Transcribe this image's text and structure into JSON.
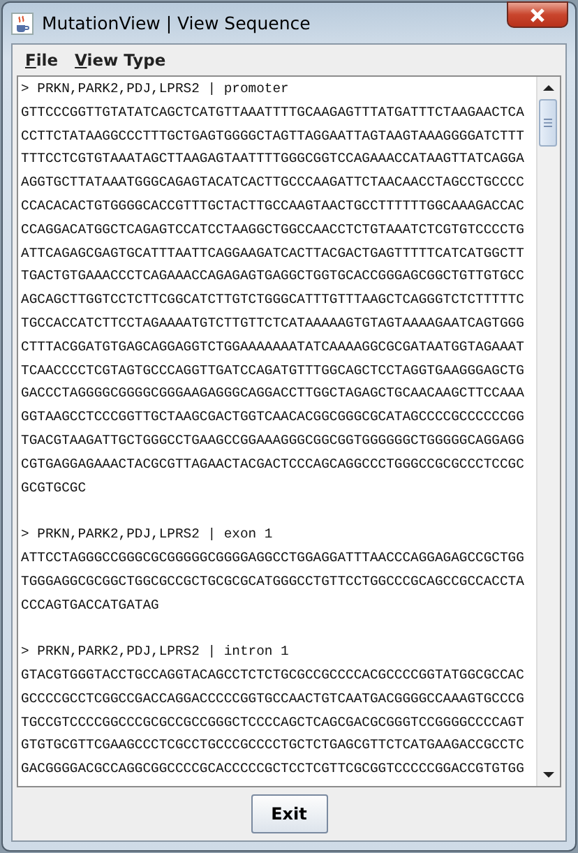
{
  "window": {
    "title": "MutationView | View Sequence"
  },
  "menu": [
    {
      "label": "File"
    },
    {
      "label": "View Type"
    }
  ],
  "records": [
    {
      "header": "> PRKN,PARK2,PDJ,LPRS2 | promoter",
      "lines": [
        "GTTCCCGGTTGTATATCAGCTCATGTTAAATTTTGCAAGAGTTTATGATTTCTAAGAACTCA",
        "CCTTCTATAAGGCCCTTTGCTGAGTGGGGCTAGTTAGGAATTAGTAAGTAAAGGGGATCTTT",
        "TTTCCTCGTGTAAATAGCTTAAGAGTAATTTTGGGCGGTCCAGAAACCATAAGTTATCAGGA",
        "AGGTGCTTATAAATGGGCAGAGTACATCACTTGCCCAAGATTCTAACAACCTAGCCTGCCCC",
        "CCACACACTGTGGGGCACCGTTTGCTACTTGCCAAGTAACTGCCTTTTTTGGCAAAGACCAC",
        "CCAGGACATGGCTCAGAGTCCATCCTAAGGCTGGCCAACCTCTGTAAATCTCGTGTCCCCTG",
        "ATTCAGAGCGAGTGCATTTAATTCAGGAAGATCACTTACGACTGAGTTTTTCATCATGGCTT",
        "TGACTGTGAAACCCTCAGAAACCAGAGAGTGAGGCTGGTGCACCGGGAGCGGCTGTTGTGCC",
        "AGCAGCTTGGTCCTCTTCGGCATCTTGTCTGGGCATTTGTTTAAGCTCAGGGTCTCTTTTTC",
        "TGCCACCATCTTCCTAGAAAATGTCTTGTTCTCATAAAAAGTGTAGTAAAAGAATCAGTGGG",
        "CTTTACGGATGTGAGCAGGAGGTCTGGAAAAAAATATCAAAAGGCGCGATAATGGTAGAAAT",
        "TCAACCCCTCGTAGTGCCCAGGTTGATCCAGATGTTTGGCAGCTCCTAGGTGAAGGGAGCTG",
        "GACCCTAGGGGCGGGGCGGGAAGAGGGCAGGACCTTGGCTAGAGCTGCAACAAGCTTCCAAA",
        "GGTAAGCCTCCCGGTTGCTAAGCGACTGGTCAACACGGCGGGCGCATAGCCCCGCCCCCCGG",
        "TGACGTAAGATTGCTGGGCCTGAAGCCGGAAAGGGCGGCGGTGGGGGGCTGGGGGCAGGAGG",
        "CGTGAGGAGAAACTACGCGTTAGAACTACGACTCCCAGCAGGCCCTGGGCCGCGCCCTCCGC",
        "GCGTGCGC"
      ]
    },
    {
      "header": "> PRKN,PARK2,PDJ,LPRS2 | exon 1",
      "lines": [
        "ATTCCTAGGGCCGGGCGCGGGGGCGGGGAGGCCTGGAGGATTTAACCCAGGAGAGCCGCTGG",
        "TGGGAGGCGCGGCTGGCGCCGCTGCGCGCATGGGCCTGTTCCTGGCCCGCAGCCGCCACCTA",
        "CCCAGTGACCATGATAG"
      ]
    },
    {
      "header": "> PRKN,PARK2,PDJ,LPRS2 | intron 1",
      "lines": [
        "GTACGTGGGTACCTGCCAGGTACAGCCTCTCTGCGCCGCCCCACGCCCCGGTATGGCGCCAC",
        "GCCCCGCCTCGGCCGACCAGGACCCCCGGTGCCAACTGTCAATGACGGGGCCAAAGTGCCCG",
        "TGCCGTCCCCGGCCCGCGCCGCCGGGCTCCCCAGCTCAGCGACGCGGGTCCGGGGCCCCAGT",
        "GTGTGCGTTCGAAGCCCTCGCCTGCCCGCCCCTGCTCTGAGCGTTCTCATGAAGACCGCCTC",
        "GACGGGGACGCCAGGCGGCCCCGCACCCCCGCTCCTCGTTCGCGGTCCCCCGGACCGTGTGG"
      ]
    }
  ],
  "buttons": [
    {
      "label": "Exit"
    }
  ]
}
